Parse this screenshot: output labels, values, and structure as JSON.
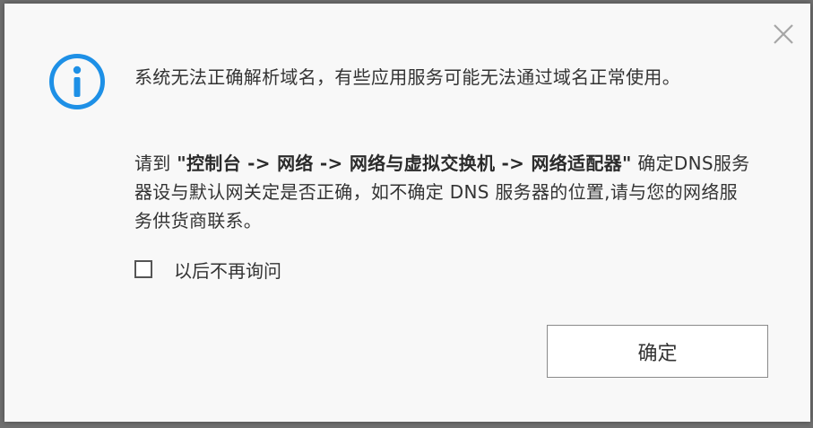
{
  "dialog": {
    "message_line1": "系统无法正确解析域名，有些应用服务可能无法通过域名正常使用。",
    "message2_prefix": "请到 ",
    "message2_path": "\"控制台 -> 网络 -> 网络与虚拟交换机 -> 网络适配器\"",
    "message2_suffix": " 确定DNS服务器设与默认网关定是否正确，如不确定 DNS 服务器的位置,请与您的网络服务供货商联系。",
    "checkbox_label": "以后不再询问",
    "checkbox_checked": false,
    "ok_label": "确定",
    "info_icon": "info-icon",
    "close_icon": "close-icon",
    "accent_color": "#1e90e6"
  }
}
